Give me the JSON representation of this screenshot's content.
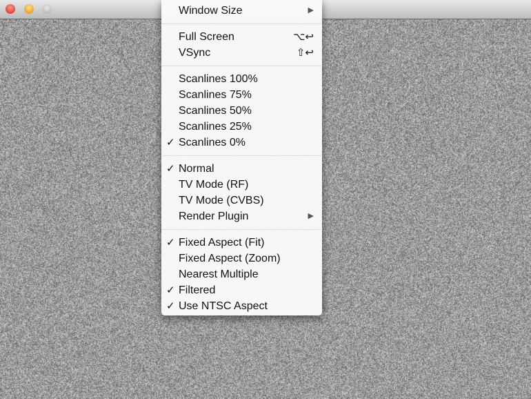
{
  "window": {
    "controls": [
      "close",
      "minimize",
      "zoom"
    ]
  },
  "menu": {
    "groups": [
      [
        {
          "label": "Window Size",
          "submenu": true
        }
      ],
      [
        {
          "label": "Full Screen",
          "shortcut": "⌥↩"
        },
        {
          "label": "VSync",
          "shortcut": "⇧↩"
        }
      ],
      [
        {
          "label": "Scanlines 100%"
        },
        {
          "label": "Scanlines 75%"
        },
        {
          "label": "Scanlines 50%"
        },
        {
          "label": "Scanlines 25%"
        },
        {
          "label": "Scanlines 0%",
          "checked": true
        }
      ],
      [
        {
          "label": "Normal",
          "checked": true
        },
        {
          "label": "TV Mode (RF)"
        },
        {
          "label": "TV Mode (CVBS)"
        },
        {
          "label": "Render Plugin",
          "submenu": true
        }
      ],
      [
        {
          "label": "Fixed Aspect (Fit)",
          "checked": true
        },
        {
          "label": "Fixed Aspect (Zoom)"
        },
        {
          "label": "Nearest Multiple"
        },
        {
          "label": "Filtered",
          "checked": true
        },
        {
          "label": "Use NTSC Aspect",
          "checked": true
        }
      ]
    ],
    "check_mark": "✓",
    "submenu_arrow": "▶"
  }
}
